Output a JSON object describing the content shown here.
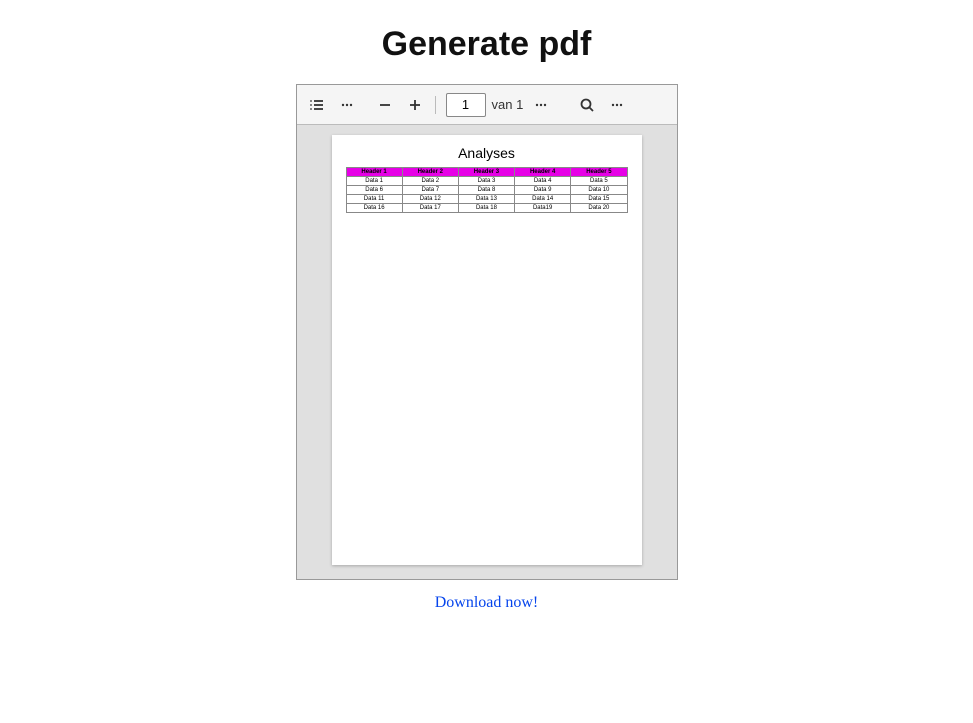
{
  "page_title": "Generate pdf",
  "toolbar": {
    "current_page": "1",
    "page_of_prefix": "van",
    "total_pages": "1"
  },
  "document": {
    "title": "Analyses",
    "headers": [
      "Header 1",
      "Header 2",
      "Header 3",
      "Header 4",
      "Header 5"
    ],
    "rows": [
      [
        "Data 1",
        "Data 2",
        "Data 3",
        "Data 4",
        "Data 5"
      ],
      [
        "Data 6",
        "Data 7",
        "Data 8",
        "Data 9",
        "Data 10"
      ],
      [
        "Data 11",
        "Data 12",
        "Data 13",
        "Data 14",
        "Data 15"
      ],
      [
        "Data 16",
        "Data 17",
        "Data 18",
        "Data19",
        "Data 20"
      ]
    ]
  },
  "download_label": "Download now!"
}
